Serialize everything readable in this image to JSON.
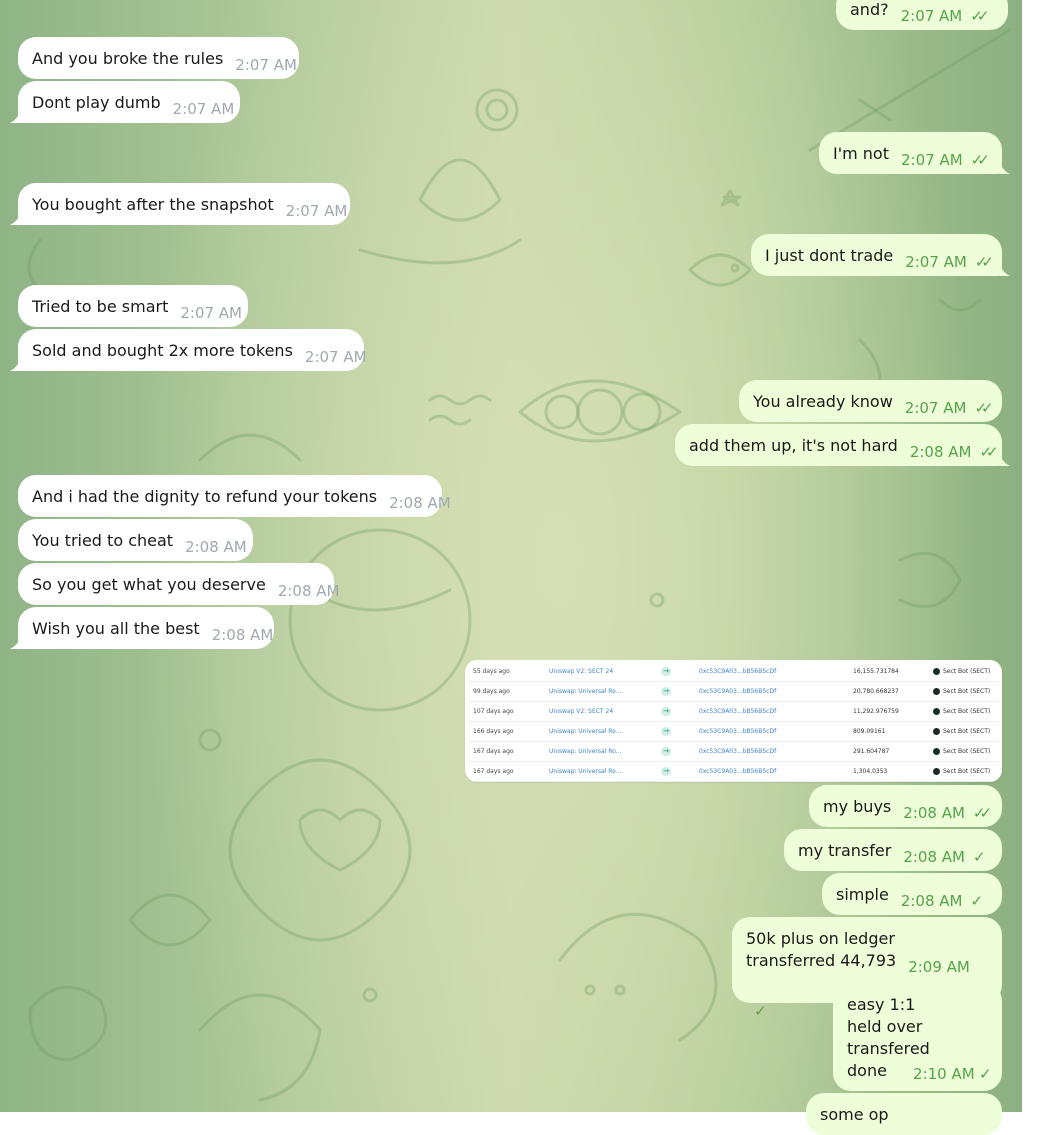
{
  "messages": [
    {
      "id": "m1",
      "dir": "out",
      "text": "and?",
      "time": "2:07 AM",
      "status": "read"
    },
    {
      "id": "m2",
      "dir": "in",
      "text": "And you broke the rules",
      "time": "2:07 AM"
    },
    {
      "id": "m3",
      "dir": "in",
      "text": "Dont play dumb",
      "time": "2:07 AM"
    },
    {
      "id": "m4",
      "dir": "out",
      "text": "I'm not",
      "time": "2:07 AM",
      "status": "read"
    },
    {
      "id": "m5",
      "dir": "in",
      "text": "You bought after the snapshot",
      "time": "2:07 AM"
    },
    {
      "id": "m6",
      "dir": "out",
      "text": "I just dont trade",
      "time": "2:07 AM",
      "status": "read"
    },
    {
      "id": "m7",
      "dir": "in",
      "text": "Tried to be smart",
      "time": "2:07 AM"
    },
    {
      "id": "m8",
      "dir": "in",
      "text": "Sold and bought 2x more tokens",
      "time": "2:07 AM"
    },
    {
      "id": "m9",
      "dir": "out",
      "text": "You already know",
      "time": "2:07 AM",
      "status": "read"
    },
    {
      "id": "m10",
      "dir": "out",
      "text": "add them up, it's not hard",
      "time": "2:08 AM",
      "status": "read"
    },
    {
      "id": "m11",
      "dir": "in",
      "text": "And i had the dignity to refund your tokens",
      "time": "2:08 AM"
    },
    {
      "id": "m12",
      "dir": "in",
      "text": "You tried to cheat",
      "time": "2:08 AM"
    },
    {
      "id": "m13",
      "dir": "in",
      "text": "So you get what you deserve",
      "time": "2:08 AM"
    },
    {
      "id": "m14",
      "dir": "in",
      "text": "Wish you all the best",
      "time": "2:08 AM"
    },
    {
      "id": "m15",
      "dir": "out",
      "text": "my buys",
      "time": "2:08 AM",
      "status": "read"
    },
    {
      "id": "m16",
      "dir": "out",
      "text": "my transfer",
      "time": "2:08 AM",
      "status": "sent"
    },
    {
      "id": "m17",
      "dir": "out",
      "text": "simple",
      "time": "2:08 AM",
      "status": "sent"
    },
    {
      "id": "m18",
      "dir": "out",
      "lines": [
        "50k plus on ledger",
        "transferred 44,793"
      ],
      "time": "2:09 AM",
      "status": "sent"
    },
    {
      "id": "m19",
      "dir": "out",
      "lines": [
        "easy 1:1",
        "held over",
        "transfered",
        "done"
      ],
      "time": "2:10 AM",
      "status": "sent"
    }
  ],
  "screenshot_table": {
    "rows": [
      {
        "age": "55 days ago",
        "method": "Uniswap V2: SECT 24",
        "address": "0xc53C9A03...bB56B5cDf",
        "amount": "16,155.731784",
        "token": "Sect Bot (SECT)"
      },
      {
        "age": "99 days ago",
        "method": "Uniswap: Universal Ro...",
        "address": "0xc53C9A03...bB56B5cDf",
        "amount": "20,780.668237",
        "token": "Sect Bot (SECT)"
      },
      {
        "age": "107 days ago",
        "method": "Uniswap V2: SECT 24",
        "address": "0xc53C9A03...bB56B5cDf",
        "amount": "11,292.976759",
        "token": "Sect Bot (SECT)"
      },
      {
        "age": "166 days ago",
        "method": "Uniswap: Universal Ro...",
        "address": "0xc53C9A03...bB56B5cDf",
        "amount": "809.09161",
        "token": "Sect Bot (SECT)"
      },
      {
        "age": "167 days ago",
        "method": "Uniswap: Universal Ro...",
        "address": "0xc53C9A03...bB56B5cDf",
        "amount": "291.604787",
        "token": "Sect Bot (SECT)"
      },
      {
        "age": "167 days ago",
        "method": "Uniswap: Universal Ro...",
        "address": "0xc53C9A03...bB56B5cDf",
        "amount": "1,304.0353",
        "token": "Sect Bot (SECT)"
      }
    ]
  },
  "partial_message_text": "some op",
  "colors": {
    "incoming_bubble": "#ffffff",
    "outgoing_bubble": "#eefed8",
    "outgoing_meta": "#56a24b",
    "incoming_meta": "#a0a8b0"
  },
  "icons": {
    "read": "double-check-icon",
    "sent": "single-check-icon",
    "copy": "copy-icon",
    "arrow": "arrow-right-icon",
    "doc": "document-icon"
  }
}
